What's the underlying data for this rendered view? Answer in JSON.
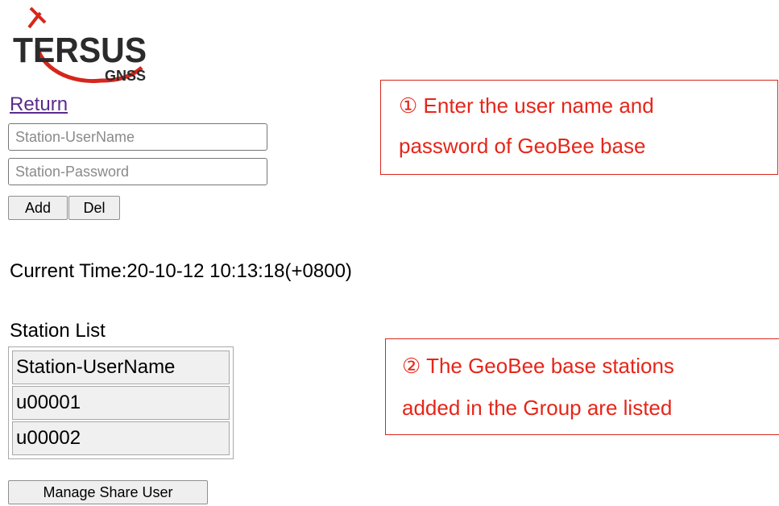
{
  "logo": {
    "brand": "TERSUS",
    "sub": "GNSS",
    "color_red": "#d6261b",
    "color_dark": "#2b2b2b"
  },
  "nav": {
    "return_label": "Return"
  },
  "form": {
    "username_placeholder": "Station-UserName",
    "password_placeholder": "Station-Password",
    "add_label": "Add",
    "del_label": "Del"
  },
  "status": {
    "current_time": "Current Time:20-10-12 10:13:18(+0800)"
  },
  "station_list": {
    "title": "Station List",
    "header": "Station-UserName",
    "rows": [
      "u00001",
      "u00002"
    ],
    "manage_label": "Manage Share User"
  },
  "annotations": [
    {
      "lines": [
        "① Enter the user name and",
        "password of GeoBee base"
      ]
    },
    {
      "lines": [
        "② The GeoBee base stations",
        "added in the Group are listed"
      ]
    }
  ],
  "colors": {
    "annotation": "#e5261a",
    "link": "#5a2c8e"
  }
}
